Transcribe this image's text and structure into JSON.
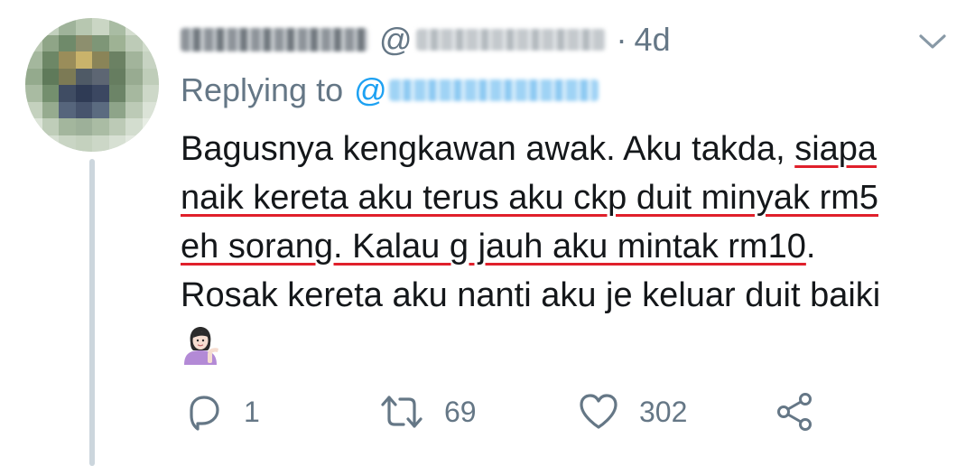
{
  "tweet": {
    "handle_prefix": "@",
    "separator": "·",
    "time": "4d",
    "replying_label": "Replying to",
    "replying_at": "@",
    "text_lines": [
      {
        "plain": "Bagusnya kengkawan awak. Aku takda, ",
        "highlight": "siapa",
        "tail": ""
      },
      {
        "plain": "",
        "highlight": "naik kereta aku terus aku ckp duit minyak rm5",
        "tail": ""
      },
      {
        "plain": "",
        "highlight": "eh sorang. Kalau g jauh aku mintak rm10",
        "tail": "."
      },
      {
        "plain": "Rosak kereta aku nanti aku je keluar duit baiki",
        "highlight": "",
        "tail": ""
      }
    ],
    "emoji": "person-tipping-hand-emoji",
    "highlight_color": "#e0202b"
  },
  "actions": {
    "reply_count": "1",
    "retweet_count": "69",
    "like_count": "302"
  },
  "colors": {
    "text": "#14171a",
    "secondary": "#657786",
    "accent": "#1da1f2",
    "thread_line": "#ccd6dd"
  }
}
